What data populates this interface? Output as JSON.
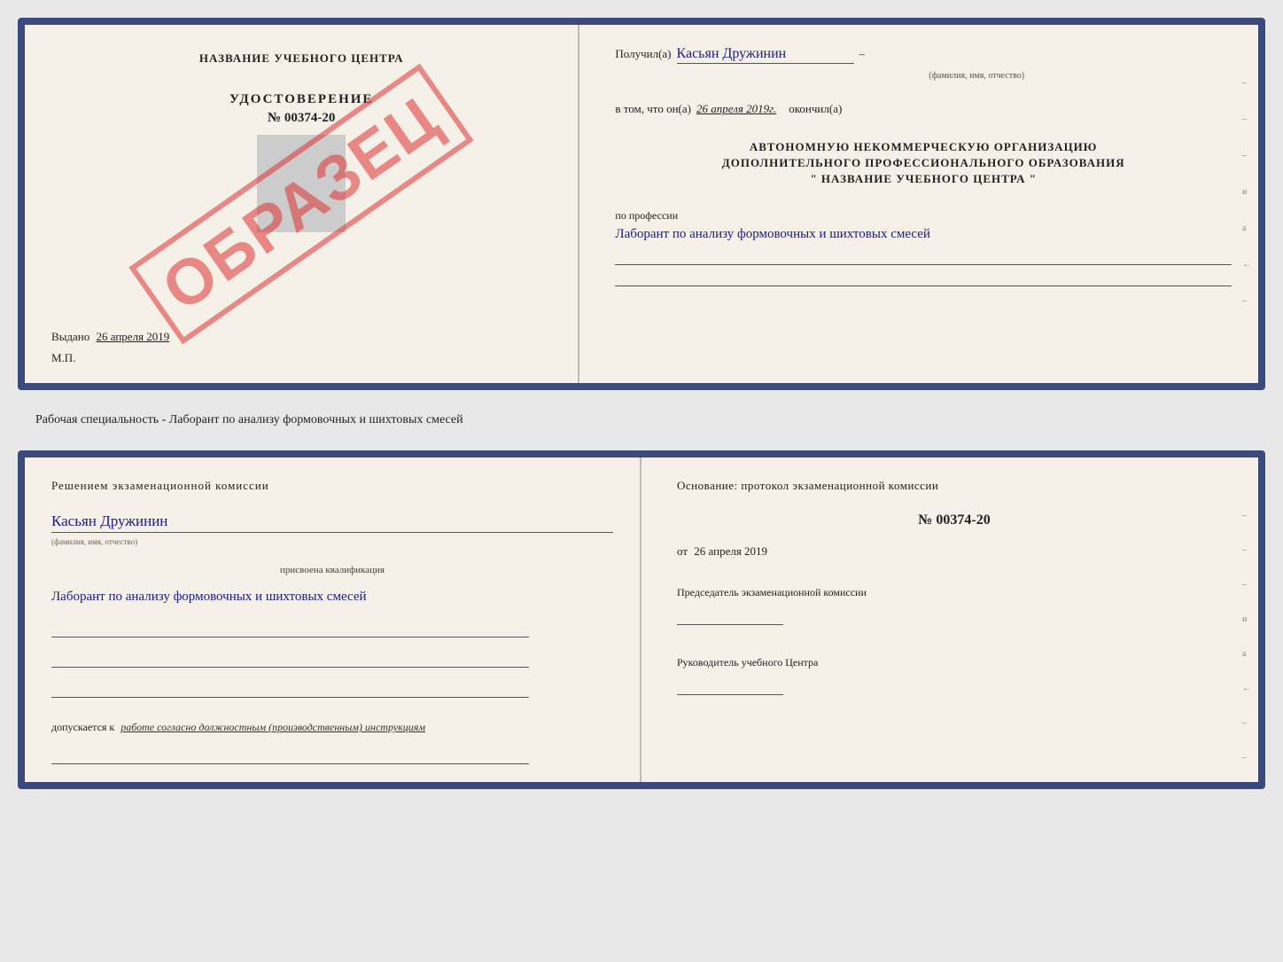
{
  "top_document": {
    "left": {
      "center_title": "НАЗВАНИЕ УЧЕБНОГО ЦЕНТРА",
      "cert_label": "УДОСТОВЕРЕНИЕ",
      "cert_number": "№ 00374-20",
      "stamp_text": "ОБРАЗЕЦ",
      "issued_prefix": "Выдано",
      "issued_date": "26 апреля 2019",
      "mp_label": "М.П."
    },
    "right": {
      "received_prefix": "Получил(а)",
      "received_name": "Касьян Дружинин",
      "name_sublabel": "(фамилия, имя, отчество)",
      "date_prefix": "в том, что он(а)",
      "date_value": "26 апреля 2019г.",
      "completed_suffix": "окончил(а)",
      "org_line1": "АВТОНОМНУЮ НЕКОММЕРЧЕСКУЮ ОРГАНИЗАЦИЮ",
      "org_line2": "ДОПОЛНИТЕЛЬНОГО ПРОФЕССИОНАЛЬНОГО ОБРАЗОВАНИЯ",
      "org_name": "\"  НАЗВАНИЕ УЧЕБНОГО ЦЕНТРА  \"",
      "profession_label": "по профессии",
      "profession_value": "Лаборант по анализу формовочных и шихтовых смесей",
      "margin_marks": [
        "–",
        "–",
        "–",
        "и",
        "а",
        "←",
        "–"
      ]
    }
  },
  "middle_text": "Рабочая специальность - Лаборант по анализу формовочных и шихтовых смесей",
  "bottom_document": {
    "left": {
      "decision_label": "Решением экзаменационной комиссии",
      "person_name": "Касьян Дружинин",
      "name_sublabel": "(фамилия, имя, отчество)",
      "assigned_label": "присвоена квалификация",
      "qualification": "Лаборант по анализу формовочных и шихтовых смесей",
      "allowed_prefix": "допускается к",
      "allowed_text": "работе согласно должностным (производственным) инструкциям"
    },
    "right": {
      "basis_title": "Основание: протокол экзаменационной комиссии",
      "protocol_number": "№ 00374-20",
      "protocol_date_prefix": "от",
      "protocol_date": "26 апреля 2019",
      "chairman_label": "Председатель экзаменационной комиссии",
      "director_label": "Руководитель учебного Центра",
      "margin_marks": [
        "–",
        "–",
        "–",
        "и",
        "а",
        "←",
        "–",
        "–"
      ]
    }
  }
}
